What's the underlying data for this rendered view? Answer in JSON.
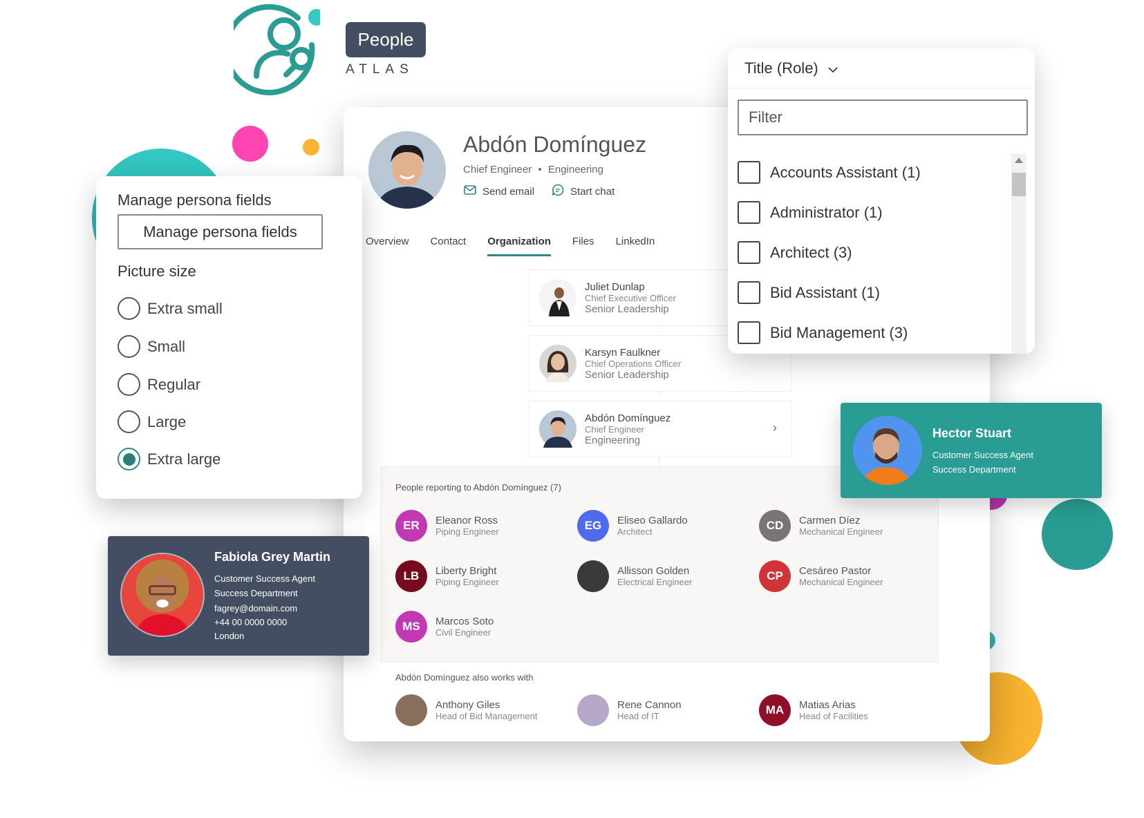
{
  "brand": {
    "badge": "People",
    "subtitle": "ATLAS",
    "colors": {
      "teal": "#2a9d93",
      "navy": "#444e63",
      "pink": "#ff44b4",
      "orange": "#fbb532",
      "aqua": "#33c9c4"
    }
  },
  "profile": {
    "name": "Abdón Domínguez",
    "title": "Chief Engineer",
    "separator": "•",
    "department": "Engineering",
    "actions": [
      {
        "label": "Send email",
        "icon": "mail-icon"
      },
      {
        "label": "Start chat",
        "icon": "chat-icon"
      }
    ],
    "tabs": [
      {
        "label": "Overview",
        "active": false
      },
      {
        "label": "Contact",
        "active": false
      },
      {
        "label": "Organization",
        "active": true
      },
      {
        "label": "Files",
        "active": false
      },
      {
        "label": "LinkedIn",
        "active": false
      }
    ]
  },
  "org_chain": [
    {
      "name": "Juliet Dunlap",
      "role": "Chief Executive Officer",
      "department": "Senior Leadership"
    },
    {
      "name": "Karsyn Faulkner",
      "role": "Chief Operations Officer",
      "department": "Senior Leadership"
    },
    {
      "name": "Abdón Domínguez",
      "role": "Chief Engineer",
      "department": "Engineering"
    }
  ],
  "reports": {
    "title": "People reporting to Abdón Domínguez (7)",
    "people": [
      {
        "initials": "ER",
        "name": "Eleanor Ross",
        "role": "Piping Engineer",
        "color": "#c239b3"
      },
      {
        "initials": "EG",
        "name": "Eliseo Gallardo",
        "role": "Architect",
        "color": "#4f6bed"
      },
      {
        "initials": "CD",
        "name": "Carmen Díez",
        "role": "Mechanical Engineer",
        "color": "#7a7574"
      },
      {
        "initials": "LB",
        "name": "Liberty Bright",
        "role": "Piping Engineer",
        "color": "#750b1c"
      },
      {
        "initials": "",
        "name": "Allisson Golden",
        "role": "Electrical Engineer",
        "color": "#3b3a39"
      },
      {
        "initials": "CP",
        "name": "Cesáreo Pastor",
        "role": "Mechanical Engineer",
        "color": "#d13438"
      },
      {
        "initials": "MS",
        "name": "Marcos Soto",
        "role": "Civil Engineer",
        "color": "#c239b3"
      }
    ]
  },
  "works_with": {
    "title": "Abdón Domínguez also works with",
    "people": [
      {
        "initials": "",
        "name": "Anthony Giles",
        "role": "Head of Bid Management",
        "color": "#8a6e5c"
      },
      {
        "initials": "",
        "name": "Rene Cannon",
        "role": "Head of IT",
        "color": "#b6a8c8"
      },
      {
        "initials": "MA",
        "name": "Matias Arias",
        "role": "Head of Facilities",
        "color": "#8e0f26"
      }
    ]
  },
  "filter": {
    "header": "Title (Role)",
    "placeholder": "Filter",
    "options": [
      {
        "label": "Accounts Assistant (1)",
        "checked": false
      },
      {
        "label": "Administrator (1)",
        "checked": false
      },
      {
        "label": "Architect (3)",
        "checked": false
      },
      {
        "label": "Bid Assistant (1)",
        "checked": false
      },
      {
        "label": "Bid Management (3)",
        "checked": false
      }
    ]
  },
  "settings": {
    "title": "Manage persona fields",
    "button_label": "Manage persona fields",
    "picture_size_label": "Picture size",
    "sizes": [
      {
        "label": "Extra small",
        "checked": false
      },
      {
        "label": "Small",
        "checked": false
      },
      {
        "label": "Regular",
        "checked": false
      },
      {
        "label": "Large",
        "checked": false
      },
      {
        "label": "Extra large",
        "checked": true
      }
    ]
  },
  "contact_cards": [
    {
      "name": "Fabiola Grey Martin",
      "role": "Customer Success Agent",
      "department": "Success Department",
      "email": "fagrey@domain.com",
      "phone": "+44 00 0000 0000",
      "location": "London"
    },
    {
      "name": "Hector Stuart",
      "role": "Customer Success Agent",
      "department": "Success Department"
    }
  ]
}
